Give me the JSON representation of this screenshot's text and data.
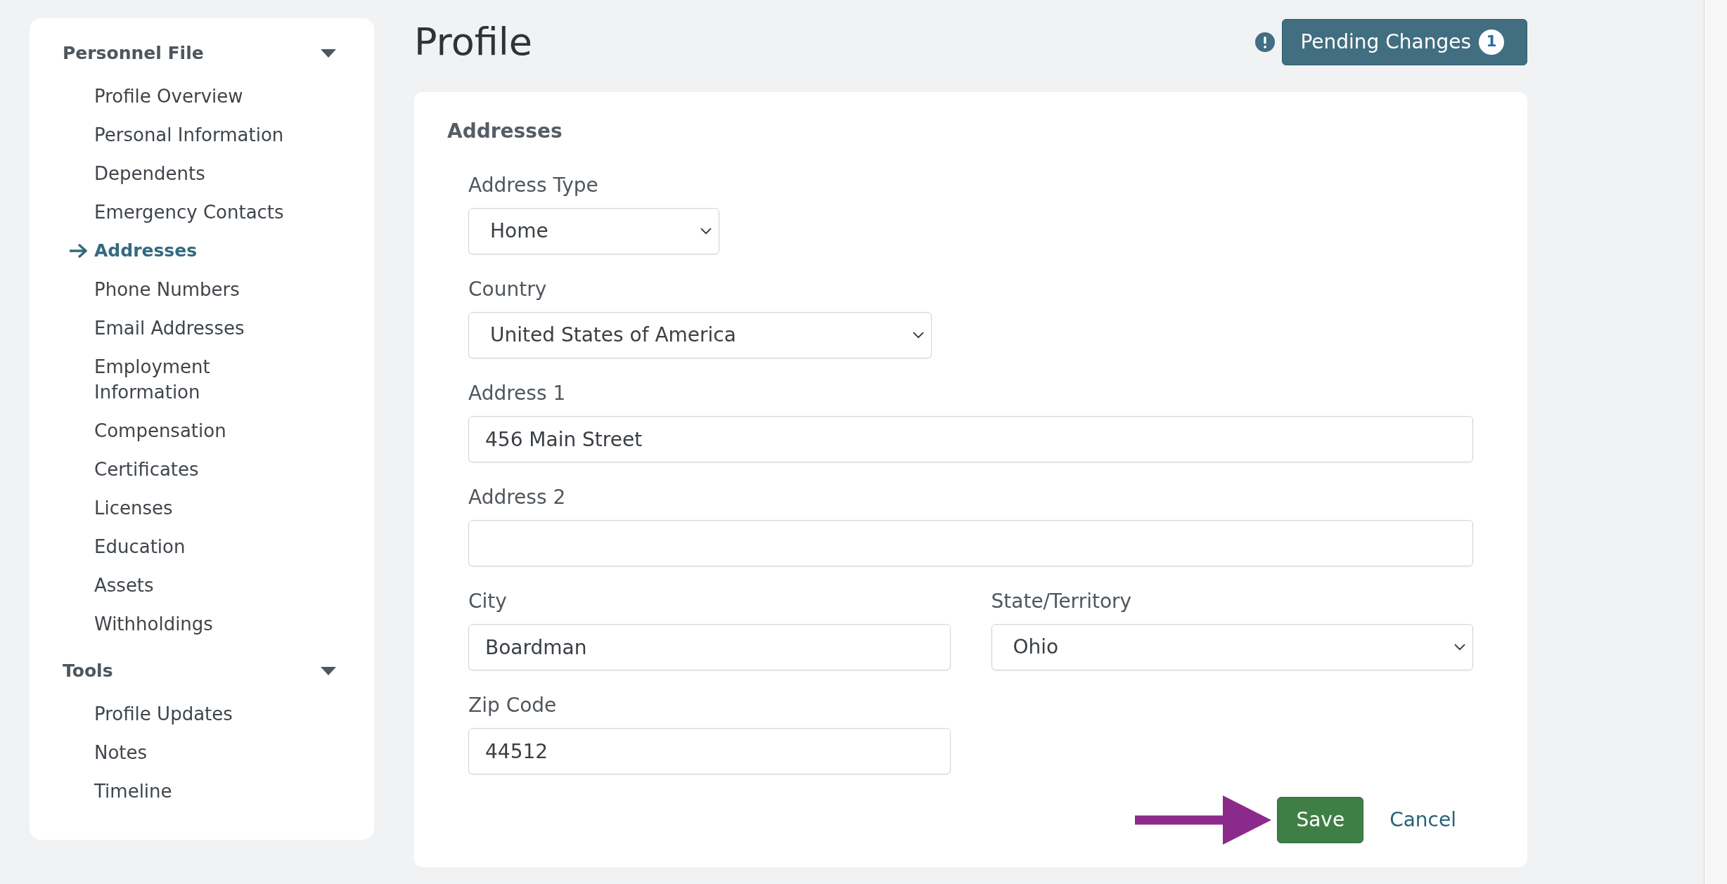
{
  "sidebar": {
    "sections": [
      {
        "title": "Personnel File",
        "expanded": true,
        "items": [
          {
            "label": "Profile Overview",
            "selected": false
          },
          {
            "label": "Personal Information",
            "selected": false
          },
          {
            "label": "Dependents",
            "selected": false
          },
          {
            "label": "Emergency Contacts",
            "selected": false
          },
          {
            "label": "Addresses",
            "selected": true
          },
          {
            "label": "Phone Numbers",
            "selected": false
          },
          {
            "label": "Email Addresses",
            "selected": false
          },
          {
            "label": "Employment Information",
            "selected": false
          },
          {
            "label": "Compensation",
            "selected": false
          },
          {
            "label": "Certificates",
            "selected": false
          },
          {
            "label": "Licenses",
            "selected": false
          },
          {
            "label": "Education",
            "selected": false
          },
          {
            "label": "Assets",
            "selected": false
          },
          {
            "label": "Withholdings",
            "selected": false
          }
        ]
      },
      {
        "title": "Tools",
        "expanded": true,
        "items": [
          {
            "label": "Profile Updates",
            "selected": false
          },
          {
            "label": "Notes",
            "selected": false
          },
          {
            "label": "Timeline",
            "selected": false
          }
        ]
      }
    ]
  },
  "header": {
    "title": "Profile",
    "pending_changes": {
      "label": "Pending Changes",
      "count": "1"
    }
  },
  "form": {
    "title": "Addresses",
    "fields": [
      {
        "label": "Address Type",
        "kind": "select",
        "value": "Home"
      },
      {
        "label": "Country",
        "kind": "select",
        "value": "United States of America"
      },
      {
        "label": "Address 1",
        "kind": "text",
        "value": "456 Main Street"
      },
      {
        "label": "Address 2",
        "kind": "text"
      },
      {
        "label": "City",
        "kind": "text",
        "value": "Boardman"
      },
      {
        "label": "State/Territory",
        "kind": "select",
        "value": "Ohio"
      },
      {
        "label": "Zip Code",
        "kind": "text",
        "value": "44512"
      }
    ],
    "actions": [
      {
        "kind": "primary",
        "label": "Save"
      },
      {
        "kind": "link",
        "label": "Cancel"
      }
    ]
  }
}
